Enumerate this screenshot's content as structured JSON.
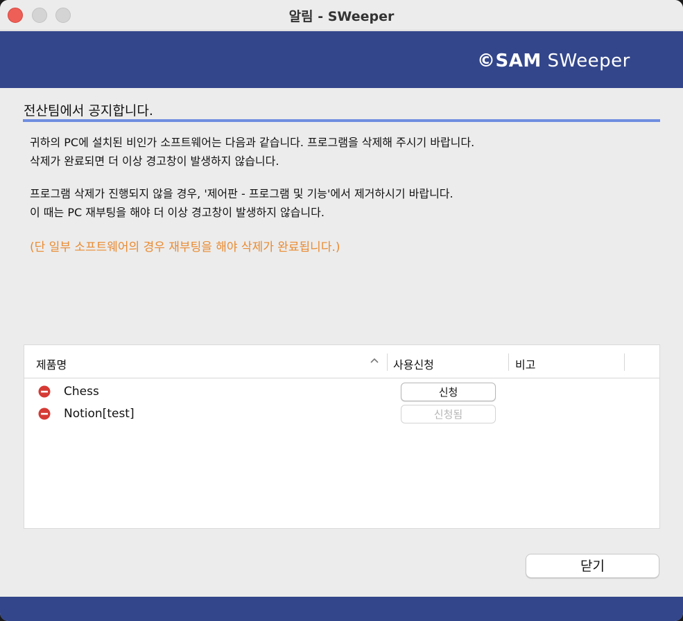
{
  "window": {
    "title": "알림 - SWeeper"
  },
  "banner": {
    "logo_symbol": "©",
    "logo_bold": "SAM",
    "logo_light": " SWeeper",
    "color": "#33468b"
  },
  "notice": {
    "heading": "전산팀에서 공지합니다.",
    "lines": [
      "귀하의 PC에 설치된 비인가 소프트웨어는 다음과 같습니다. 프로그램을 삭제해 주시기 바랍니다.",
      "삭제가 완료되면 더 이상 경고창이 발생하지 않습니다.",
      "프로그램 삭제가 진행되지 않을 경우, '제어판 - 프로그램 및 기능'에서 제거하시기 바랍니다.",
      "이 때는 PC 재부팅을 해야 더 이상 경고창이 발생하지 않습니다."
    ],
    "warning": "(단 일부 소프트웨어의 경우 재부팅을 해야 삭제가 완료됩니다.)",
    "warning_color": "#ea8a2f",
    "accent_line_color": "#6f8ee0"
  },
  "table": {
    "columns": {
      "product": "제품명",
      "request": "사용신청",
      "note": "비고"
    },
    "sort_icon": "chevron-up-icon",
    "rows": [
      {
        "icon": "minus-circle-icon",
        "name": "Chess",
        "button": "신청",
        "enabled": true
      },
      {
        "icon": "minus-circle-icon",
        "name": "Notion[test]",
        "button": "신청됨",
        "enabled": false
      }
    ]
  },
  "actions": {
    "close_label": "닫기"
  }
}
